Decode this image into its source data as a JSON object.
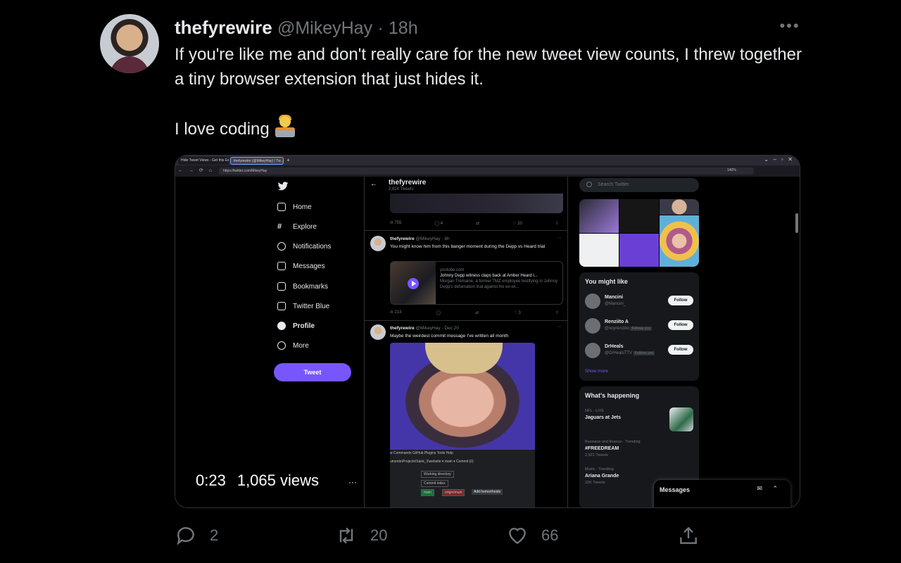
{
  "tweet": {
    "display_name": "thefyrewire",
    "handle": "@MikeyHay",
    "separator": "·",
    "time": "18h",
    "more": "•••",
    "text": "If you're like me and don't really care for the new tweet view counts, I threw together a tiny browser extension that just hides it.\n\nI love coding",
    "emoji": "technologist-emoji"
  },
  "video_overlay": {
    "duration": "0:23",
    "views": "1,065 views",
    "more": "···"
  },
  "actions": {
    "reply_count": "2",
    "retweet_count": "20",
    "like_count": "66"
  },
  "embedded": {
    "browser": {
      "tab1": "Hide Tweet Views - Get this Ex...",
      "tab2": "thefyrewire (@MikeyHay) / Tw...",
      "url": "https://twitter.com/MikeyHay",
      "zoom": "140%"
    },
    "sidebar": [
      "Home",
      "Explore",
      "Notifications",
      "Messages",
      "Bookmarks",
      "Twitter Blue",
      "Profile",
      "More"
    ],
    "tweet_button": "Tweet",
    "profile": {
      "name": "thefyrewire",
      "tweets": "2,824 Tweets"
    },
    "post1": {
      "stats": [
        "755",
        "4",
        "",
        "20",
        ""
      ]
    },
    "post2": {
      "name": "thefyrewire",
      "meta": "@MikeyHay · 8h",
      "text": "You might know him from this banger moment during the Depp vs Heard trial",
      "card_domain": "youtube.com",
      "card_title": "Johnny Depp witness claps back at Amber Heard l...",
      "card_desc": "Morgan Tremaine, a former TMZ employee testifying in Johnny Depp's defamation trial against his ex-wi...",
      "stats": [
        "213",
        "",
        "",
        "3",
        ""
      ]
    },
    "post3": {
      "name": "thefyrewire",
      "meta": "@MikeyHay · Dec 20",
      "text": "Maybe the weirdest commit message I've written all month",
      "editor_menu": "w    Commands    GitHub    Plugins    Tools    Help",
      "editor_path": "uments\\Projects\\Saint_3\\website  ▾  main  ▾  Commit (0)",
      "node1": "Working directory",
      "node2": "Commit index",
      "node3": "main",
      "node4": "origin/main",
      "commit_msg": "Add hemorrhoids"
    },
    "search_placeholder": "Search Twitter",
    "wtf": {
      "title": "You might like",
      "users": [
        {
          "name": "Mancini",
          "handle": "@Mancini_",
          "follows_you": ""
        },
        {
          "name": "Renziito A",
          "handle": "@xoyrenziito",
          "follows_you": "Follows you"
        },
        {
          "name": "DrHeals",
          "handle": "@DrHealsTTV",
          "follows_you": "Follows you"
        }
      ],
      "follow_label": "Follow",
      "show_more": "Show more"
    },
    "trends": {
      "title": "What's happening",
      "items": [
        {
          "category": "NFL · LIVE",
          "name": "Jaguars at Jets",
          "count": ""
        },
        {
          "category": "Business and finance · Trending",
          "name": "#FREEDREAM",
          "count": "2,921 Tweets"
        },
        {
          "category": "Music · Trending",
          "name": "Ariana Grande",
          "count": "22K Tweets"
        }
      ]
    },
    "messages_dock": "Messages"
  },
  "colors": {
    "background": "#000000",
    "text": "#e7e9ea",
    "muted": "#71767b",
    "accent": "#7856ff"
  }
}
